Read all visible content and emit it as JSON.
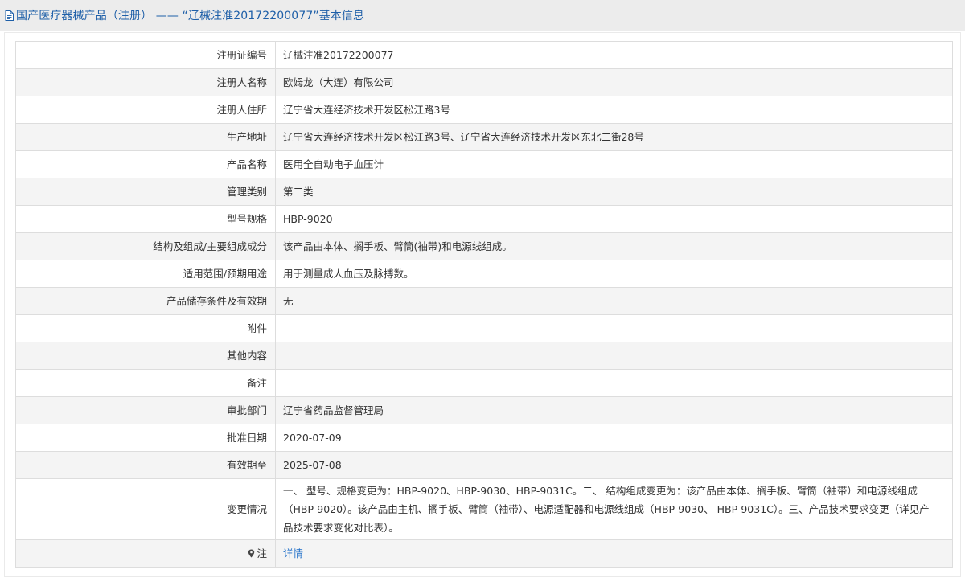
{
  "header": {
    "title": "国产医疗器械产品（注册） —— “辽械注准20172200077”基本信息",
    "icon": "document-icon"
  },
  "colors": {
    "title_blue": "#1e5fa8",
    "link_blue": "#1e6ec8",
    "header_bg": "#ececec",
    "row_alt_bg": "#f4f4f4",
    "border": "#dddddd"
  },
  "rows": [
    {
      "label": "注册证编号",
      "value": "辽械注准20172200077"
    },
    {
      "label": "注册人名称",
      "value": "欧姆龙（大连）有限公司"
    },
    {
      "label": "注册人住所",
      "value": "辽宁省大连经济技术开发区松江路3号"
    },
    {
      "label": "生产地址",
      "value": "辽宁省大连经济技术开发区松江路3号、辽宁省大连经济技术开发区东北二街28号"
    },
    {
      "label": "产品名称",
      "value": "医用全自动电子血压计"
    },
    {
      "label": "管理类别",
      "value": "第二类"
    },
    {
      "label": "型号规格",
      "value": "HBP-9020"
    },
    {
      "label": "结构及组成/主要组成成分",
      "value": "该产品由本体、搁手板、臂筒(袖带)和电源线组成。"
    },
    {
      "label": "适用范围/预期用途",
      "value": "用于测量成人血压及脉搏数。"
    },
    {
      "label": "产品储存条件及有效期",
      "value": "无"
    },
    {
      "label": "附件",
      "value": ""
    },
    {
      "label": "其他内容",
      "value": ""
    },
    {
      "label": "备注",
      "value": ""
    },
    {
      "label": "审批部门",
      "value": "辽宁省药品监督管理局"
    },
    {
      "label": "批准日期",
      "value": "2020-07-09"
    },
    {
      "label": "有效期至",
      "value": "2025-07-08"
    },
    {
      "label": "变更情况",
      "value": "一、 型号、规格变更为：HBP-9020、HBP-9030、HBP-9031C。二、 结构组成变更为：该产品由本体、搁手板、臂筒（袖带）和电源线组成（HBP-9020）。该产品由主机、搁手板、臂筒（袖带）、电源适配器和电源线组成（HBP-9030、 HBP-9031C）。三、产品技术要求变更（详见产品技术要求变化对比表）。"
    }
  ],
  "note": {
    "label": "注",
    "icon": "pin-icon",
    "link_text": "详情"
  }
}
